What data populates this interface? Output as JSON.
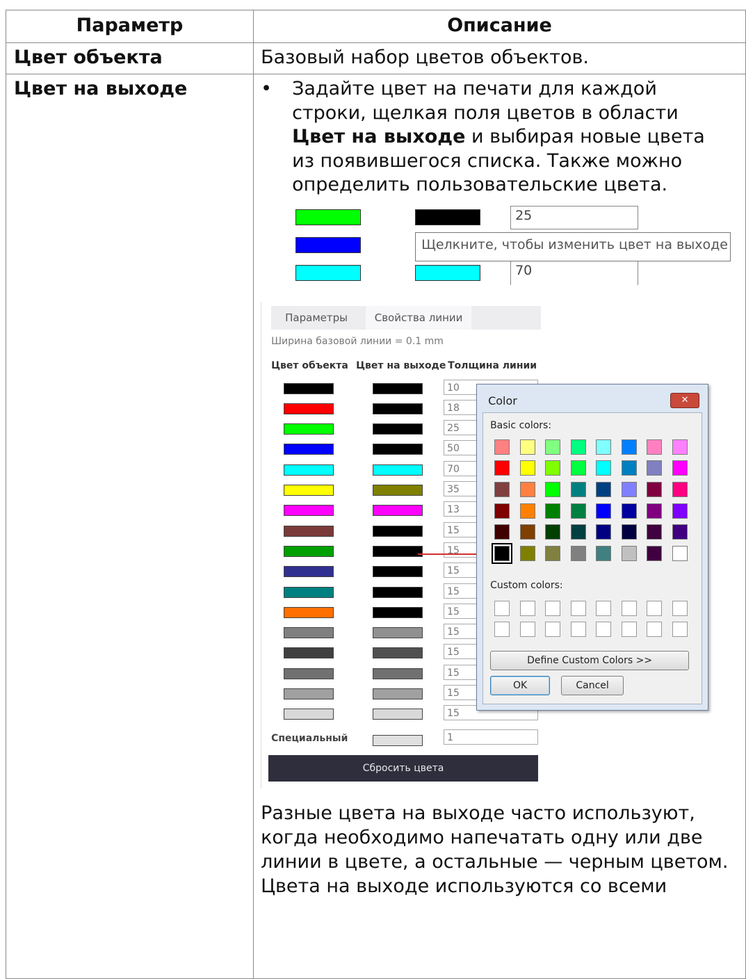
{
  "table": {
    "header_param": "Параметр",
    "header_desc": "Описание",
    "row1": {
      "param": "Цвет объекта",
      "desc": "Базовый набор цветов объектов."
    },
    "row2": {
      "param": "Цвет на выходе",
      "bullet_dot": "•",
      "bullet_part1": "Задайте цвет на печати для каждой строки, щелкая поля цветов в области ",
      "bullet_bold": "Цвет на выходе",
      "bullet_part2": " и выбирая новые цвета из появившегося списка. Также можно определить пользовательские цвета.",
      "after_text": "Разные цвета на выходе часто используют, когда необходимо напечатать одну или две линии в цвете, а остальные — черным цветом. Цвета на выходе используются со всеми"
    }
  },
  "figure1": {
    "rows": [
      {
        "object_color": "#00ff00",
        "output_color": "#000000",
        "width": "25"
      },
      {
        "object_color": "#0000ff",
        "output_color": "",
        "width": ""
      },
      {
        "object_color": "#00ffff",
        "output_color": "#00ffff",
        "width": "70"
      }
    ],
    "tooltip": "Щелкните, чтобы изменить цвет на выходе"
  },
  "figure2": {
    "tab_params": "Параметры",
    "tab_line_props": "Свойства линии",
    "base_width": "Ширина базовой линии = 0.1   mm",
    "col_object": "Цвет объекта",
    "col_output": "Цвет на выходе",
    "col_width": "Толщина линии",
    "rows": [
      {
        "obj": "#000000",
        "out": "#000000",
        "w": "10"
      },
      {
        "obj": "#ff0000",
        "out": "#000000",
        "w": "18"
      },
      {
        "obj": "#00ff00",
        "out": "#000000",
        "w": "25"
      },
      {
        "obj": "#0000ff",
        "out": "#000000",
        "w": "50"
      },
      {
        "obj": "#00ffff",
        "out": "#00ffff",
        "w": "70"
      },
      {
        "obj": "#ffff00",
        "out": "#808000",
        "w": "35"
      },
      {
        "obj": "#ff00ff",
        "out": "#ff00ff",
        "w": "13"
      },
      {
        "obj": "#7a3a3a",
        "out": "#000000",
        "w": "15"
      },
      {
        "obj": "#00a000",
        "out": "#000000",
        "w": "15"
      },
      {
        "obj": "#303090",
        "out": "#000000",
        "w": "15"
      },
      {
        "obj": "#008080",
        "out": "#000000",
        "w": "15"
      },
      {
        "obj": "#ff7000",
        "out": "#000000",
        "w": "15"
      },
      {
        "obj": "#808080",
        "out": "#909090",
        "w": "15"
      },
      {
        "obj": "#404040",
        "out": "#505050",
        "w": "15"
      },
      {
        "obj": "#707070",
        "out": "#707070",
        "w": "15"
      },
      {
        "obj": "#a0a0a0",
        "out": "#a0a0a0",
        "w": "15"
      },
      {
        "obj": "#d8d8d8",
        "out": "#d8d8d8",
        "w": "15"
      }
    ],
    "special_label": "Специальный",
    "special_out": "#e0e0e0",
    "special_w": "1",
    "reset_button": "Сбросить цвета",
    "dialog": {
      "title": "Color",
      "close": "✕",
      "basic_colors": "Basic colors:",
      "custom_colors": "Custom colors:",
      "define_button": "Define Custom Colors >>",
      "ok": "OK",
      "cancel": "Cancel",
      "palette": [
        [
          "#ff8080",
          "#ffff80",
          "#80ff80",
          "#00ff80",
          "#80ffff",
          "#0080ff",
          "#ff80c0",
          "#ff80ff"
        ],
        [
          "#ff0000",
          "#ffff00",
          "#80ff00",
          "#00ff40",
          "#00ffff",
          "#0080c0",
          "#8080c0",
          "#ff00ff"
        ],
        [
          "#804040",
          "#ff8040",
          "#00ff00",
          "#008080",
          "#004080",
          "#8080ff",
          "#800040",
          "#ff0080"
        ],
        [
          "#800000",
          "#ff8000",
          "#008000",
          "#008040",
          "#0000ff",
          "#0000a0",
          "#800080",
          "#8000ff"
        ],
        [
          "#400000",
          "#804000",
          "#004000",
          "#004040",
          "#000080",
          "#000040",
          "#400040",
          "#400080"
        ],
        [
          "#000000",
          "#808000",
          "#808040",
          "#808080",
          "#408080",
          "#c0c0c0",
          "#400040",
          "#ffffff"
        ]
      ]
    }
  }
}
